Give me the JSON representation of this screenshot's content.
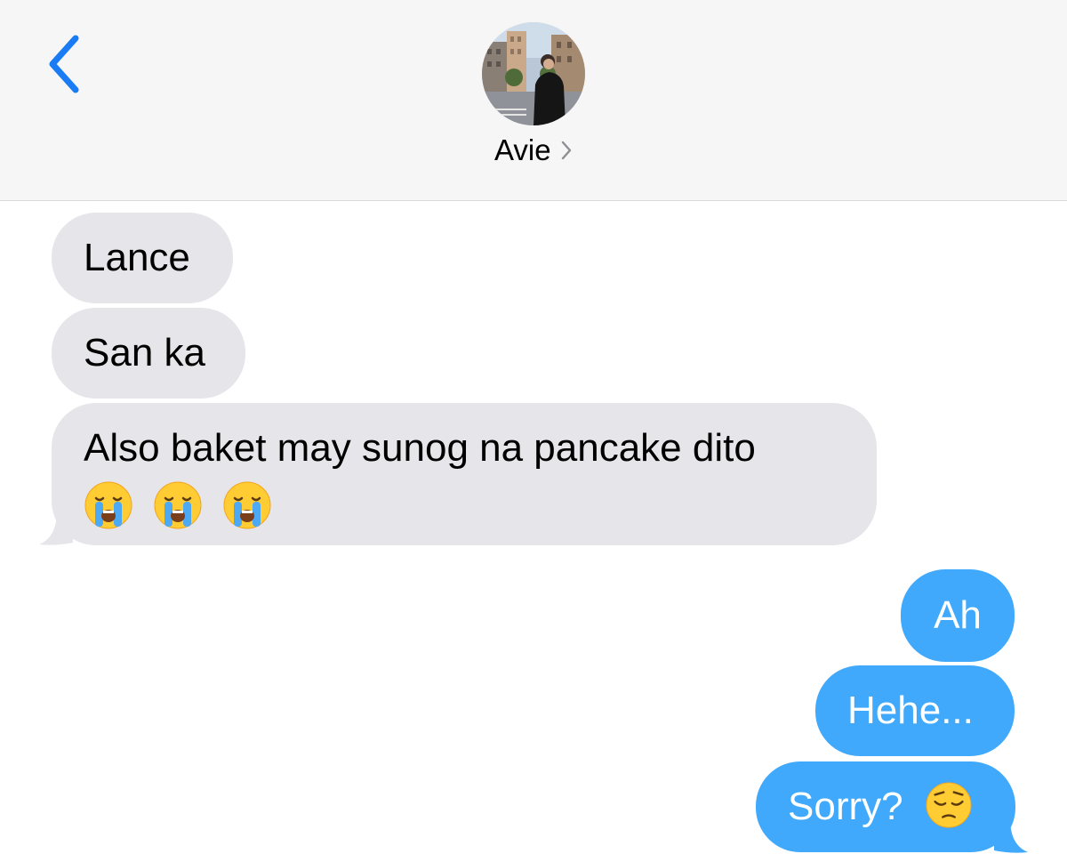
{
  "header": {
    "contact_name": "Avie",
    "back_icon": "chevron-left-icon",
    "name_chevron_icon": "chevron-right-icon",
    "avatar": "contact-avatar-photo"
  },
  "colors": {
    "incoming_bubble": "#e5e5ea",
    "outgoing_bubble": "#40a9fb",
    "accent": "#1a7cf5",
    "header_bg": "#f6f6f6"
  },
  "messages": [
    {
      "direction": "incoming",
      "text": "Lance"
    },
    {
      "direction": "incoming",
      "text": "San ka"
    },
    {
      "direction": "incoming",
      "text": "Also baket may sunog na pancake dito",
      "emoji": [
        "loudly-crying-face",
        "loudly-crying-face",
        "loudly-crying-face"
      ]
    },
    {
      "direction": "outgoing",
      "text": "Ah"
    },
    {
      "direction": "outgoing",
      "text": "Hehe..."
    },
    {
      "direction": "outgoing",
      "text": "Sorry?",
      "emoji": [
        "pensive-face"
      ]
    }
  ]
}
